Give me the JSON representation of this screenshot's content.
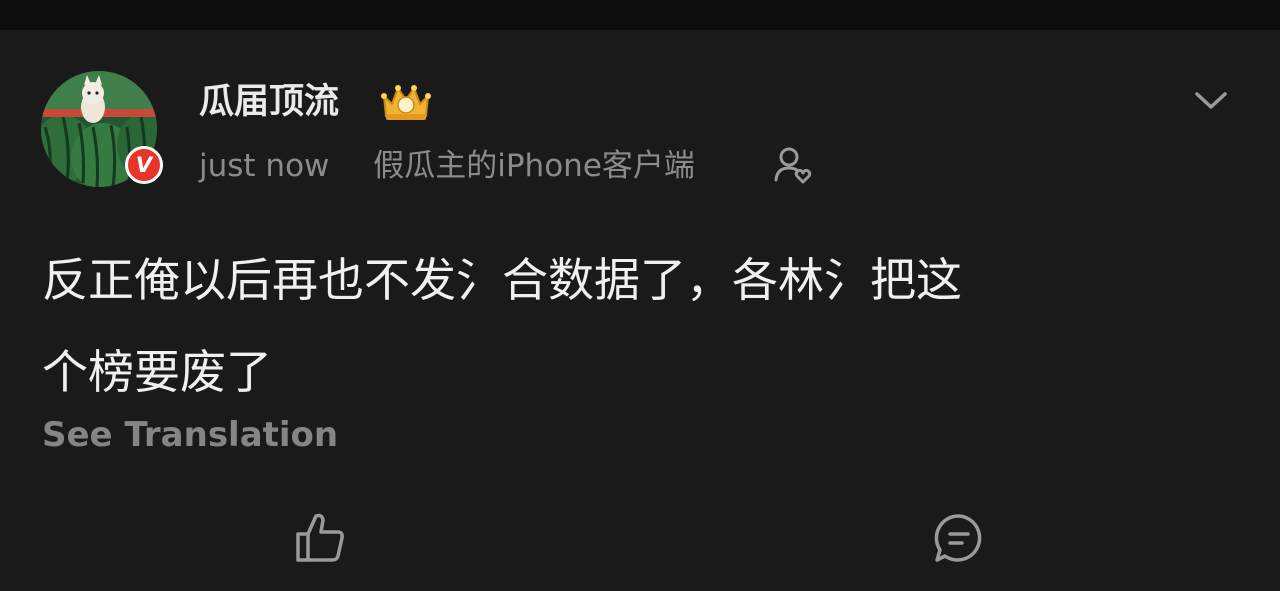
{
  "post": {
    "author": {
      "name": "瓜届顶流",
      "verified_badge": "V",
      "crown_icon": "crown-badge-icon",
      "avatar": "watermelon-avatar"
    },
    "time": "just now",
    "source": "假瓜主的iPhone客户端",
    "follow_icon": "user-heart-icon",
    "menu_icon": "chevron-down-icon",
    "content": {
      "line1": "反正俺以后再也不发氵合数据了，各林氵把这",
      "line2": "个榜要废了"
    },
    "translate_label": "See Translation",
    "actions": {
      "like_icon": "thumbs-up-icon",
      "comment_icon": "comment-icon"
    }
  },
  "colors": {
    "background": "#1a1a1a",
    "text_primary": "#f0f0f0",
    "text_secondary": "#8b8b8b",
    "badge_red": "#e7352a",
    "crown_gold": "#f2b234"
  }
}
